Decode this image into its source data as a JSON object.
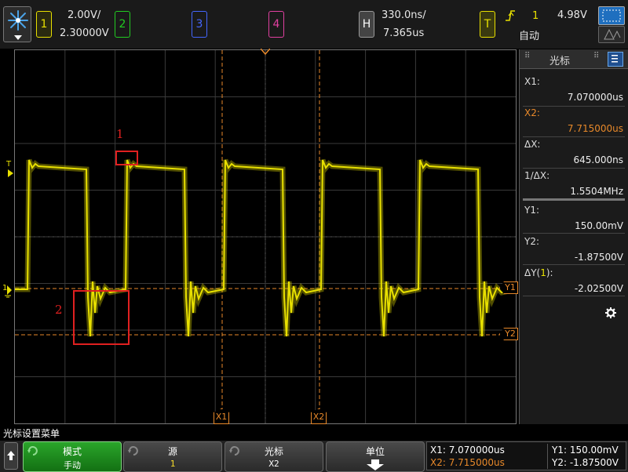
{
  "top": {
    "channel1": {
      "label": "1",
      "volts_per_div": "2.00V/",
      "offset": "2.30000V",
      "color": "#e8e000"
    },
    "channel2": {
      "label": "2",
      "color": "#22cc22"
    },
    "channel3": {
      "label": "3",
      "color": "#4466ff"
    },
    "channel4": {
      "label": "4",
      "color": "#e040a0"
    },
    "horizontal": {
      "label": "H",
      "time_per_div": "330.0ns/",
      "delay": "7.365us"
    },
    "trigger": {
      "label": "T",
      "source": "1",
      "mode": "自动",
      "level": "4.98V"
    }
  },
  "markers": {
    "trigger_level": "T",
    "ground": "1",
    "y1": "Y1",
    "y2": "Y2",
    "x1": "X1",
    "x2": "X2"
  },
  "annotations": {
    "box1": "1",
    "box2": "2"
  },
  "panel": {
    "title": "光标",
    "x1_label": "X1:",
    "x1_value": "7.070000us",
    "x2_label": "X2:",
    "x2_value": "7.715000us",
    "dx_label": "ΔX:",
    "dx_value": "645.000ns",
    "inv_dx_label": "1/ΔX:",
    "inv_dx_value": "1.5504MHz",
    "y1_label": "Y1:",
    "y1_value": "150.00mV",
    "y2_label": "Y2:",
    "y2_value": "-1.87500V",
    "dy_label_prefix": "ΔY(",
    "dy_label_ch": "1",
    "dy_label_suffix": "):",
    "dy_value": "-2.02500V"
  },
  "menu": {
    "title": "光标设置菜单",
    "mode_label": "模式",
    "mode_value": "手动",
    "source_label": "源",
    "source_value": "1",
    "cursor_label": "光标",
    "cursor_value": "X2",
    "units_label": "单位"
  },
  "readout": {
    "x1": "X1: 7.070000us",
    "x2": "X2: 7.715000us",
    "y1": "Y1: 150.00mV",
    "y2": "Y2: -1.87500V"
  },
  "colors": {
    "trace": "#e8e000",
    "cursor": "#e8892a",
    "annotation": "#e02020"
  }
}
